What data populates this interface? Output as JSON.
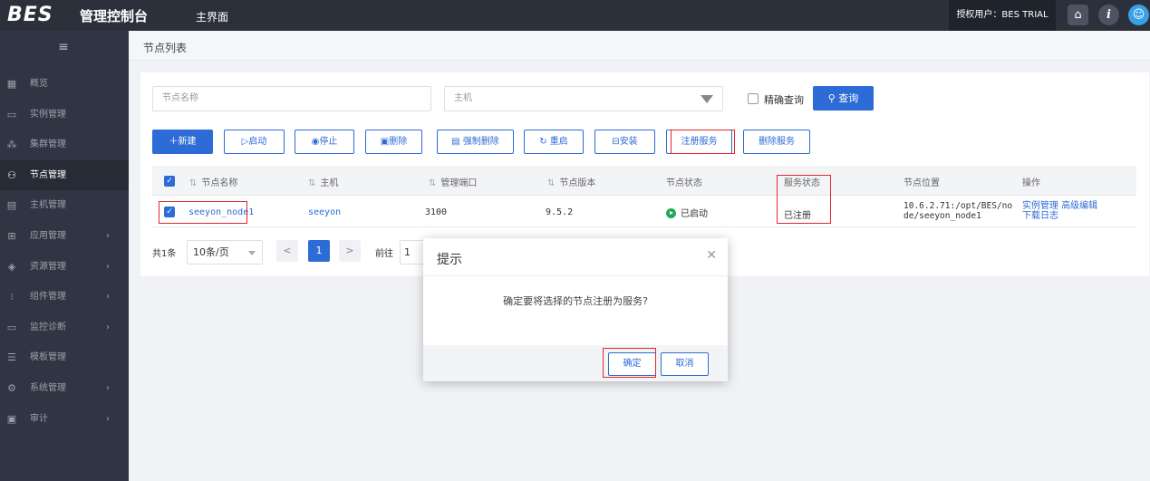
{
  "header": {
    "logo": "BES",
    "logo_sub": "管理控制台",
    "main_nav": "主界面",
    "user": "授权用户：BES TRIAL"
  },
  "sidebar": {
    "items": [
      {
        "label": "概览",
        "icon": "dashboard-icon"
      },
      {
        "label": "实例管理",
        "icon": "instance-icon"
      },
      {
        "label": "集群管理",
        "icon": "cluster-icon"
      },
      {
        "label": "节点管理",
        "icon": "node-icon",
        "active": true
      },
      {
        "label": "主机管理",
        "icon": "host-icon"
      },
      {
        "label": "应用管理",
        "icon": "app-icon",
        "expandable": true
      },
      {
        "label": "资源管理",
        "icon": "resource-icon",
        "expandable": true
      },
      {
        "label": "组件管理",
        "icon": "component-icon",
        "expandable": true
      },
      {
        "label": "监控诊断",
        "icon": "monitor-icon",
        "expandable": true
      },
      {
        "label": "模板管理",
        "icon": "template-icon"
      },
      {
        "label": "系统管理",
        "icon": "settings-icon",
        "expandable": true
      },
      {
        "label": "审计",
        "icon": "audit-icon",
        "expandable": true
      }
    ]
  },
  "breadcrumb": "节点列表",
  "filters": {
    "name_placeholder": "节点名称",
    "host_placeholder": "主机",
    "exact_label": "精确查询",
    "query_label": "查询"
  },
  "toolbar": {
    "new": "新建",
    "start": "启动",
    "stop": "停止",
    "delete": "删除",
    "force_delete": "强制删除",
    "restart": "重启",
    "install": "安装",
    "register": "注册服务",
    "unregister": "删除服务"
  },
  "table": {
    "headers": {
      "name": "节点名称",
      "host": "主机",
      "port": "管理端口",
      "version": "节点版本",
      "status": "节点状态",
      "service": "服务状态",
      "location": "节点位置",
      "actions": "操作"
    },
    "rows": [
      {
        "name": "seeyon_node1",
        "host": "seeyon",
        "port": "3100",
        "version": "9.5.2",
        "status": "已启动",
        "service": "已注册",
        "location_1": "10.6.2.71:/opt/BES/no",
        "location_2": "de/seeyon_node1",
        "action_instance": "实例管理",
        "action_edit": "高级编辑",
        "action_log": "下载日志"
      }
    ]
  },
  "pagination": {
    "total": "共1条",
    "page_size": "10条/页",
    "current": "1",
    "goto_label": "前往",
    "goto_value": "1"
  },
  "modal": {
    "title": "提示",
    "message": "确定要将选择的节点注册为服务?",
    "confirm": "确定",
    "cancel": "取消"
  },
  "colors": {
    "accent": "#2d6bd6",
    "sidebar": "#2f3542",
    "topbar": "#2b303b",
    "highlight": "#e0282e",
    "running": "#22a85b"
  }
}
